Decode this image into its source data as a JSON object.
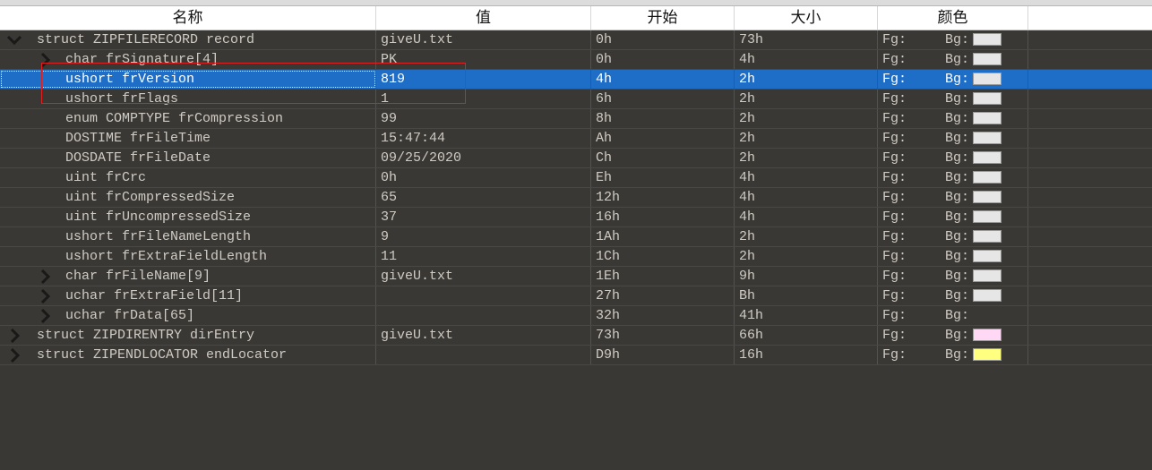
{
  "headers": {
    "name": "名称",
    "value": "值",
    "start": "开始",
    "size": "大小",
    "color": "颜色"
  },
  "fg_label": "Fg:",
  "bg_label": "Bg:",
  "colors": {
    "selected_row": "#1e6ec8",
    "highlight_box": "#e02020",
    "bg_default": "#e6e6e6",
    "bg_direntry": "#ffd8f6",
    "bg_endlocator": "#ffff80"
  },
  "rows": [
    {
      "name": "struct ZIPFILERECORD record",
      "value": "giveU.txt",
      "start": "0h",
      "size": "73h",
      "bg_color": "#e6e6e6",
      "indent": 0,
      "arrow": "expanded"
    },
    {
      "name": "char frSignature[4]",
      "value": "PK",
      "start": "0h",
      "size": "4h",
      "bg_color": "#e6e6e6",
      "indent": 1,
      "arrow": "collapsed"
    },
    {
      "name": "ushort frVersion",
      "value": "819",
      "start": "4h",
      "size": "2h",
      "bg_color": "#e6e6e6",
      "indent": 1,
      "arrow": "none",
      "selected": true
    },
    {
      "name": "ushort frFlags",
      "value": "1",
      "start": "6h",
      "size": "2h",
      "bg_color": "#e6e6e6",
      "indent": 1,
      "arrow": "none"
    },
    {
      "name": "enum COMPTYPE frCompression",
      "value": "99",
      "start": "8h",
      "size": "2h",
      "bg_color": "#e6e6e6",
      "indent": 1,
      "arrow": "none"
    },
    {
      "name": "DOSTIME frFileTime",
      "value": "15:47:44",
      "start": "Ah",
      "size": "2h",
      "bg_color": "#e6e6e6",
      "indent": 1,
      "arrow": "none"
    },
    {
      "name": "DOSDATE frFileDate",
      "value": "09/25/2020",
      "start": "Ch",
      "size": "2h",
      "bg_color": "#e6e6e6",
      "indent": 1,
      "arrow": "none"
    },
    {
      "name": "uint frCrc",
      "value": "0h",
      "start": "Eh",
      "size": "4h",
      "bg_color": "#e6e6e6",
      "indent": 1,
      "arrow": "none"
    },
    {
      "name": "uint frCompressedSize",
      "value": "65",
      "start": "12h",
      "size": "4h",
      "bg_color": "#e6e6e6",
      "indent": 1,
      "arrow": "none"
    },
    {
      "name": "uint frUncompressedSize",
      "value": "37",
      "start": "16h",
      "size": "4h",
      "bg_color": "#e6e6e6",
      "indent": 1,
      "arrow": "none"
    },
    {
      "name": "ushort frFileNameLength",
      "value": "9",
      "start": "1Ah",
      "size": "2h",
      "bg_color": "#e6e6e6",
      "indent": 1,
      "arrow": "none"
    },
    {
      "name": "ushort frExtraFieldLength",
      "value": "11",
      "start": "1Ch",
      "size": "2h",
      "bg_color": "#e6e6e6",
      "indent": 1,
      "arrow": "none"
    },
    {
      "name": "char frFileName[9]",
      "value": "giveU.txt",
      "start": "1Eh",
      "size": "9h",
      "bg_color": "#e6e6e6",
      "indent": 1,
      "arrow": "collapsed"
    },
    {
      "name": "uchar frExtraField[11]",
      "value": "",
      "start": "27h",
      "size": "Bh",
      "bg_color": "#e6e6e6",
      "indent": 1,
      "arrow": "collapsed"
    },
    {
      "name": "uchar frData[65]",
      "value": "",
      "start": "32h",
      "size": "41h",
      "bg_color": "",
      "indent": 1,
      "arrow": "collapsed"
    },
    {
      "name": "struct ZIPDIRENTRY dirEntry",
      "value": "giveU.txt",
      "start": "73h",
      "size": "66h",
      "bg_color": "#ffd8f6",
      "indent": 0,
      "arrow": "collapsed"
    },
    {
      "name": "struct ZIPENDLOCATOR endLocator",
      "value": "",
      "start": "D9h",
      "size": "16h",
      "bg_color": "#ffff80",
      "indent": 0,
      "arrow": "collapsed"
    }
  ]
}
